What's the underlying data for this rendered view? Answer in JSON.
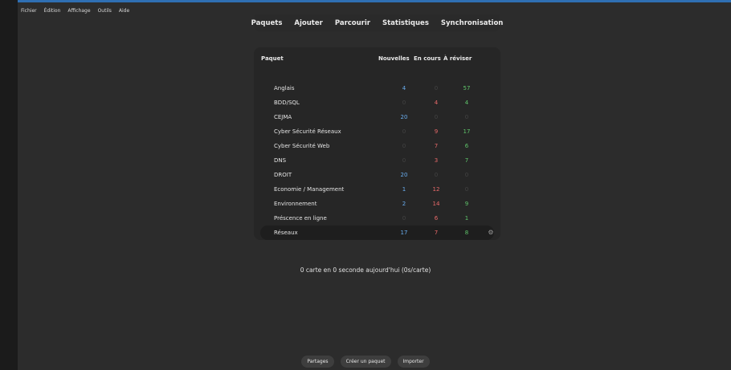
{
  "menu": [
    "Fichier",
    "Édition",
    "Affichage",
    "Outils",
    "Aide"
  ],
  "toolbar": [
    "Paquets",
    "Ajouter",
    "Parcourir",
    "Statistiques",
    "Synchronisation"
  ],
  "deck_table": {
    "headers": {
      "deck": "Paquet",
      "new": "Nouvelles",
      "learn": "En cours",
      "due": "À réviser"
    },
    "rows": [
      {
        "name": "Anglais",
        "new": "4",
        "learn": "0",
        "due": "57"
      },
      {
        "name": "BDD/SQL",
        "new": "0",
        "learn": "4",
        "due": "4"
      },
      {
        "name": "CEJMA",
        "new": "20",
        "learn": "0",
        "due": "0"
      },
      {
        "name": "Cyber Sécurité Réseaux",
        "new": "0",
        "learn": "9",
        "due": "17"
      },
      {
        "name": "Cyber Sécurité Web",
        "new": "0",
        "learn": "7",
        "due": "6"
      },
      {
        "name": "DNS",
        "new": "0",
        "learn": "3",
        "due": "7"
      },
      {
        "name": "DROIT",
        "new": "20",
        "learn": "0",
        "due": "0"
      },
      {
        "name": "Economie / Management",
        "new": "1",
        "learn": "12",
        "due": "0"
      },
      {
        "name": "Environnement",
        "new": "2",
        "learn": "14",
        "due": "9"
      },
      {
        "name": "Préscence en ligne",
        "new": "0",
        "learn": "6",
        "due": "1"
      },
      {
        "name": "Réseaux",
        "new": "17",
        "learn": "7",
        "due": "8",
        "selected": true
      }
    ]
  },
  "stats_text": "0 carte en 0 seconde aujourd'hui (0s/carte)",
  "bottom_buttons": {
    "shared": "Partages",
    "create_deck": "Créer un paquet",
    "import": "Importer"
  },
  "colors": {
    "new": "#6aaef0",
    "learn": "#e86a6a",
    "due": "#5fc46a",
    "zero": "#444444",
    "accent": "#2f6fb3"
  },
  "icons": {
    "deck_options": "gear-icon"
  }
}
